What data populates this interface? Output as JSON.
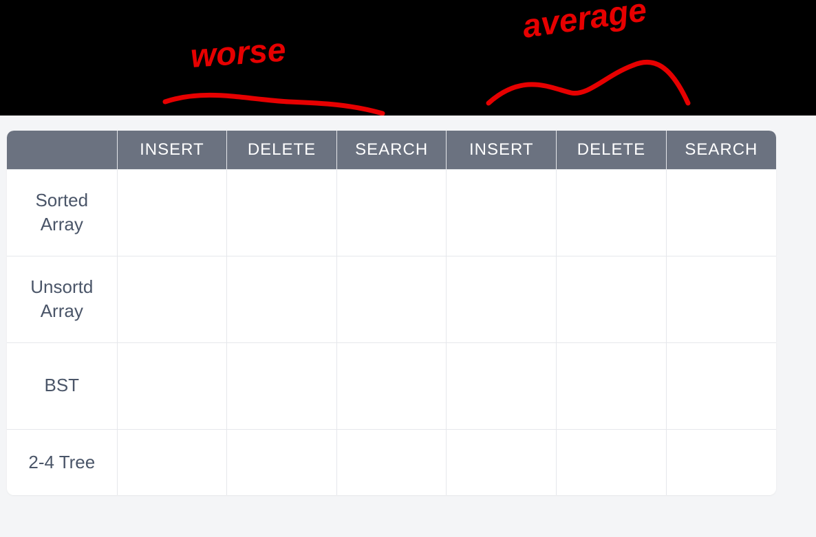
{
  "chart_data": {
    "type": "table",
    "title": "",
    "column_groups": [
      "worse",
      "average"
    ],
    "columns": [
      "INSERT",
      "DELETE",
      "SEARCH",
      "INSERT",
      "DELETE",
      "SEARCH"
    ],
    "rows": [
      {
        "label": "Sorted Array",
        "values": [
          "",
          "",
          "",
          "",
          "",
          ""
        ]
      },
      {
        "label": "Unsortd Array",
        "values": [
          "",
          "",
          "",
          "",
          "",
          ""
        ]
      },
      {
        "label": "BST",
        "values": [
          "",
          "",
          "",
          "",
          "",
          ""
        ]
      },
      {
        "label": "2-4 Tree",
        "values": [
          "",
          "",
          "",
          "",
          "",
          ""
        ]
      }
    ]
  },
  "annotations": {
    "worse": "worse",
    "average": "average"
  },
  "header": {
    "blank": "",
    "c0": "INSERT",
    "c1": "DELETE",
    "c2": "SEARCH",
    "c3": "INSERT",
    "c4": "DELETE",
    "c5": "SEARCH"
  },
  "rows": {
    "r0": {
      "label_l1": "Sorted",
      "label_l2": "Array",
      "v0": "",
      "v1": "",
      "v2": "",
      "v3": "",
      "v4": "",
      "v5": ""
    },
    "r1": {
      "label_l1": "Unsortd",
      "label_l2": "Array",
      "v0": "",
      "v1": "",
      "v2": "",
      "v3": "",
      "v4": "",
      "v5": ""
    },
    "r2": {
      "label_l1": "BST",
      "label_l2": "",
      "v0": "",
      "v1": "",
      "v2": "",
      "v3": "",
      "v4": "",
      "v5": ""
    },
    "r3": {
      "label_l1": "2-4 Tree",
      "label_l2": "",
      "v0": "",
      "v1": "",
      "v2": "",
      "v3": "",
      "v4": "",
      "v5": ""
    }
  },
  "colors": {
    "ink": "#e60000",
    "header_bg": "#6b7280",
    "header_fg": "#ffffff",
    "border": "#e5e7eb",
    "page_bg": "#f4f5f7",
    "text": "#4a5568"
  }
}
